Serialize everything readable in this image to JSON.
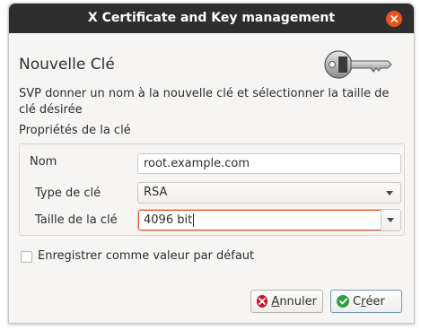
{
  "window": {
    "title": "X Certificate and Key management"
  },
  "heading": "Nouvelle Clé",
  "description": "SVP donner un nom à la nouvelle clé et sélectionner la taille de clé désirée",
  "properties": {
    "group_title": "Propriétés de la clé",
    "name_label": "Nom",
    "name_value": "root.example.com",
    "type_label": "Type de clé",
    "type_value": "RSA",
    "size_label": "Taille de la clé",
    "size_value": "4096 bit"
  },
  "default_checkbox": {
    "label": "Enregistrer comme valeur par défaut",
    "checked": false
  },
  "buttons": {
    "cancel_mnemonic": "A",
    "cancel_rest": "nnuler",
    "create_prefix": "C",
    "create_mnemonic": "r",
    "create_rest": "éer"
  },
  "colors": {
    "titlebar": "#2e2e2e",
    "close": "#e9541d",
    "focus": "#e95420",
    "cancel_icon": "#c7162b",
    "create_icon": "#2f9e44"
  },
  "icons": {
    "close": "close-icon",
    "key": "key-icon",
    "cancel": "cancel-icon",
    "create": "check-icon"
  }
}
